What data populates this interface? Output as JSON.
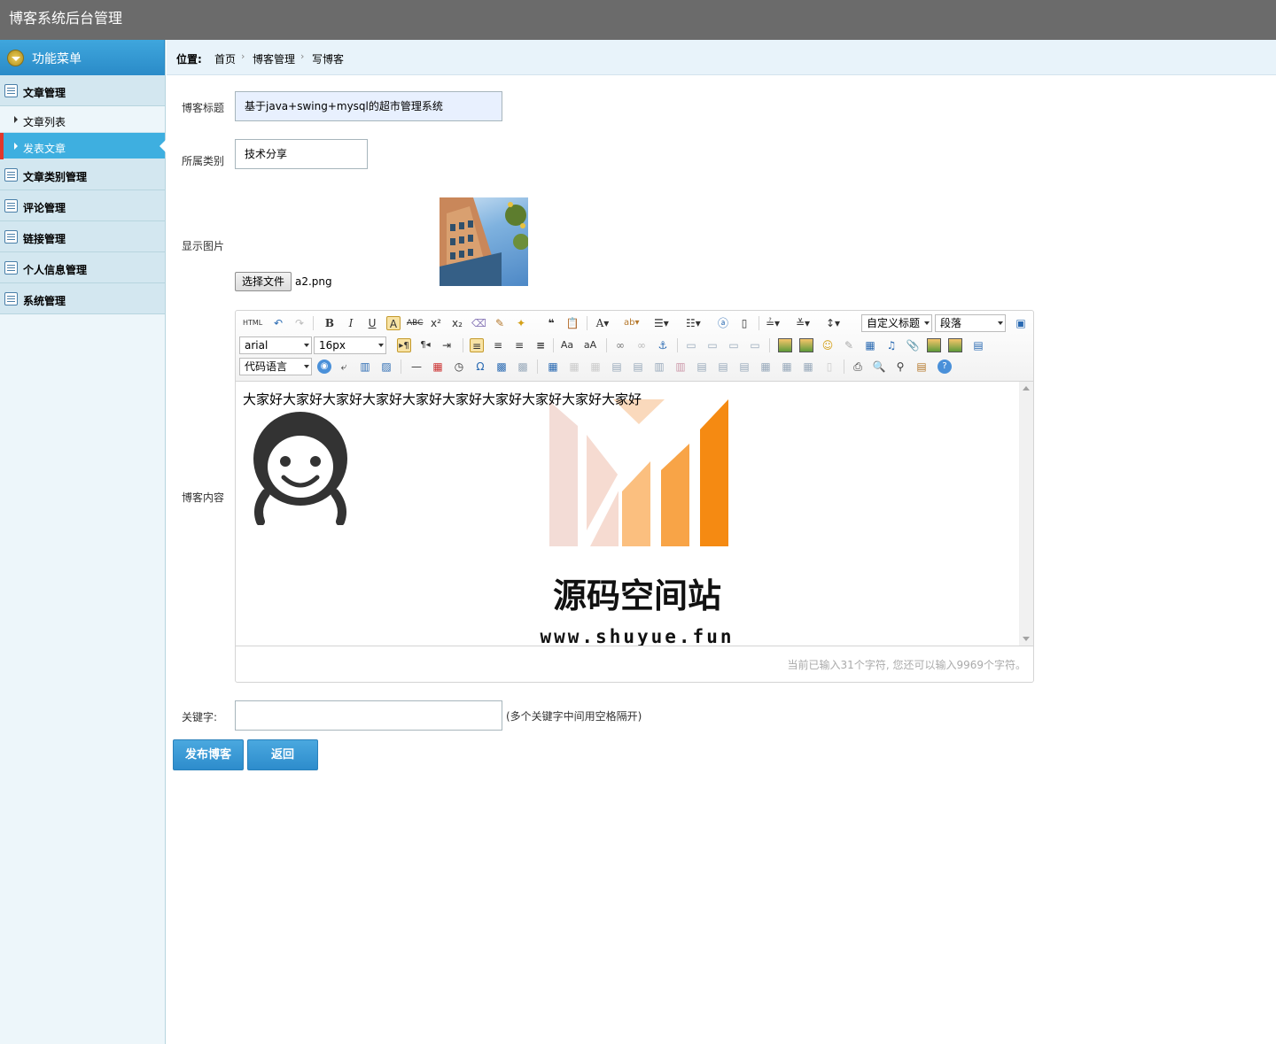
{
  "header": {
    "title": "博客系统后台管理"
  },
  "sidebar": {
    "menu_title": "功能菜单",
    "groups": [
      {
        "label": "文章管理",
        "items": [
          {
            "label": "文章列表"
          },
          {
            "label": "发表文章"
          }
        ]
      },
      {
        "label": "文章类别管理"
      },
      {
        "label": "评论管理"
      },
      {
        "label": "链接管理"
      },
      {
        "label": "个人信息管理"
      },
      {
        "label": "系统管理"
      }
    ]
  },
  "breadcrumb": {
    "prefix": "位置:",
    "items": [
      "首页",
      "博客管理",
      "写博客"
    ]
  },
  "form": {
    "title_label": "博客标题",
    "title_value": "基于java+swing+mysql的超市管理系统",
    "category_label": "所属类别",
    "category_value": "技术分享",
    "image_label": "显示图片",
    "file_button": "选择文件",
    "file_name": "a2.png",
    "content_label": "博客内容",
    "keywords_label": "关键字:",
    "keywords_value": "",
    "keywords_hint": "(多个关键字中间用空格隔开)",
    "submit_button": "发布博客",
    "back_button": "返回"
  },
  "editor": {
    "html_label": "HTML",
    "font_family": "arial",
    "font_size": "16px",
    "custom_title": "自定义标题",
    "paragraph": "段落",
    "code_language": "代码语言",
    "content_text": "大家好大家好大家好大家好大家好大家好大家好大家好大家好大家好",
    "word_count": "当前已输入31个字符, 您还可以输入9969个字符。"
  },
  "watermark": {
    "title": "源码空间站",
    "url": "www.shuyue.fun"
  }
}
